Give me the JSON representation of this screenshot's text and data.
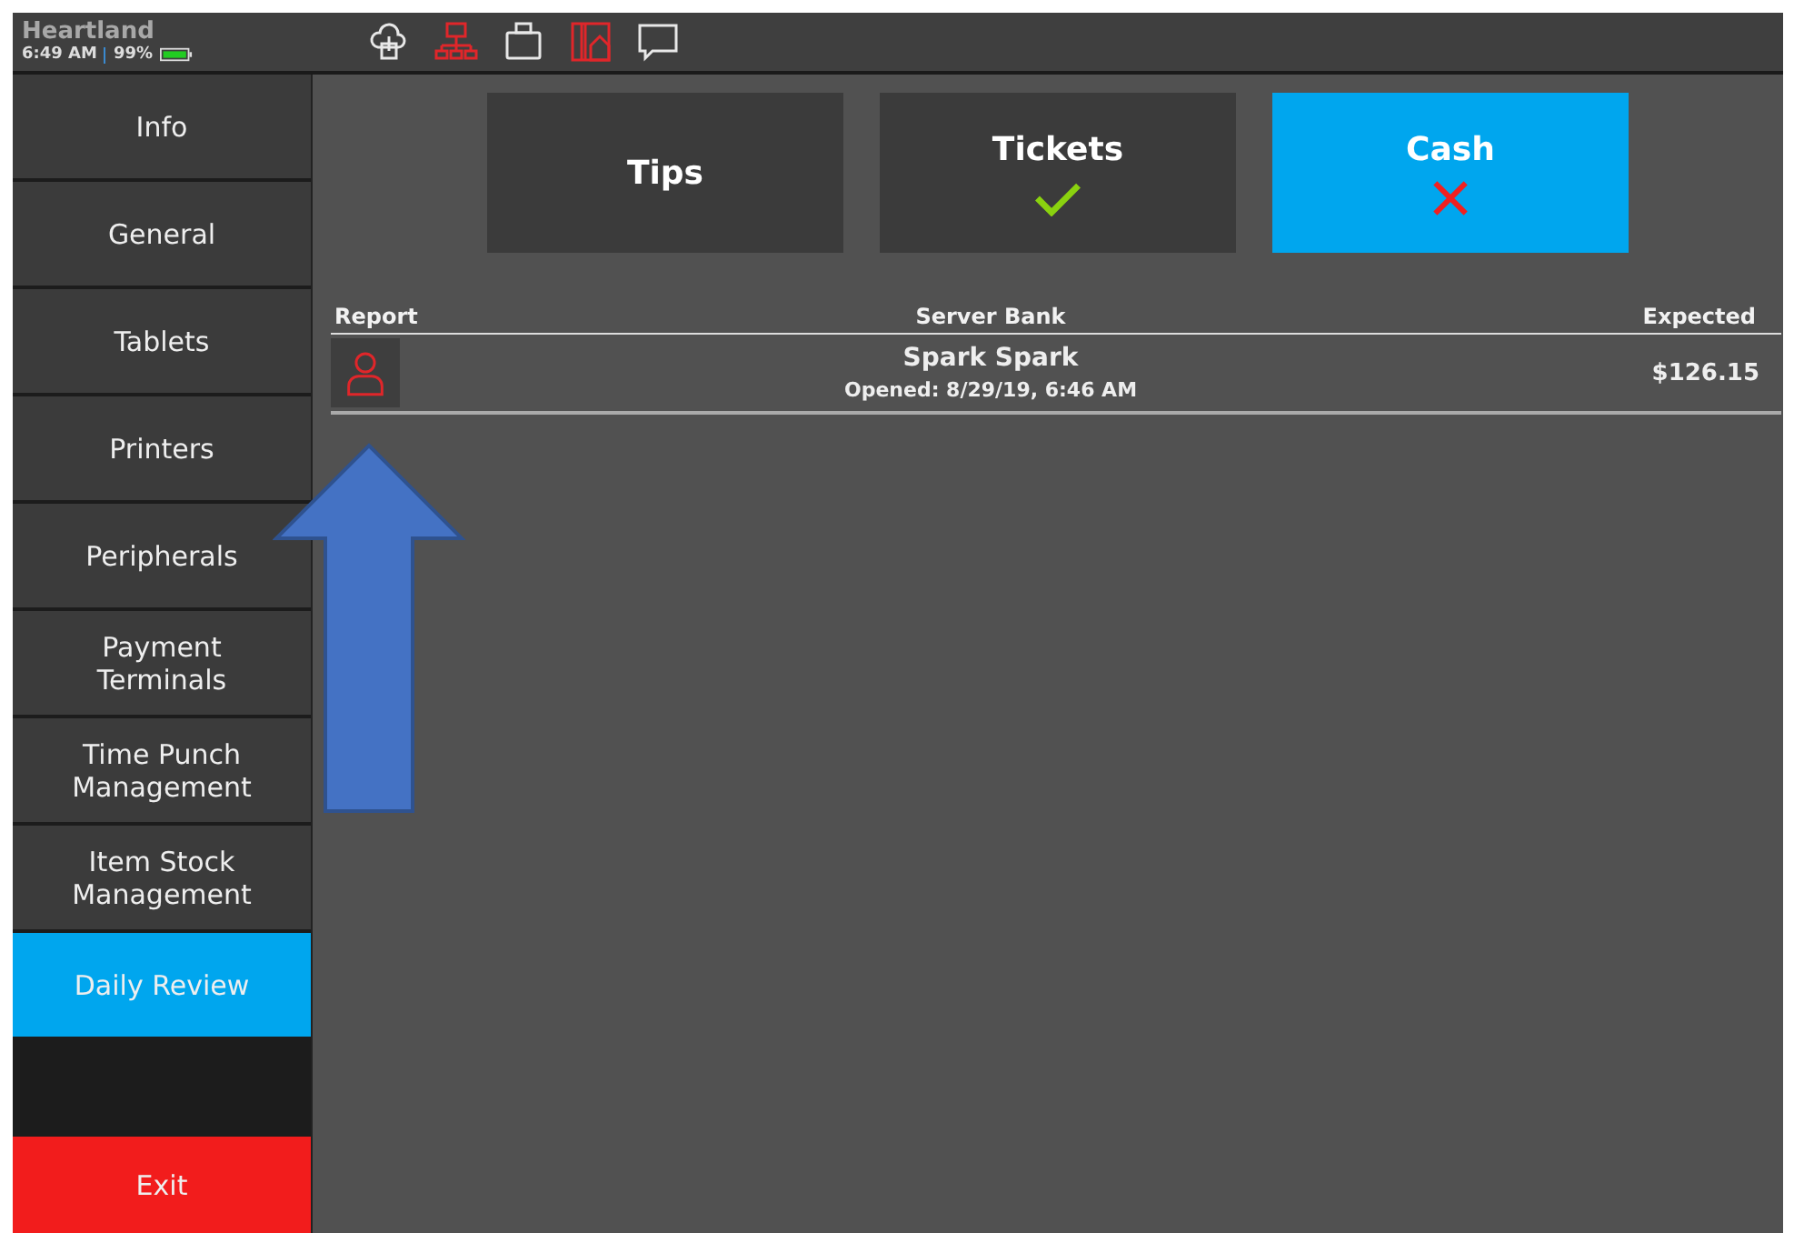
{
  "status_bar": {
    "brand": "Heartland",
    "time": "6:49 AM",
    "battery": "99%",
    "icons": [
      {
        "kind": "cloud",
        "alert": false
      },
      {
        "kind": "network",
        "alert": true
      },
      {
        "kind": "printer",
        "alert": false
      },
      {
        "kind": "card",
        "alert": true
      },
      {
        "kind": "chat",
        "alert": false
      }
    ]
  },
  "sidebar": {
    "items": [
      {
        "label": "Info",
        "selected": false
      },
      {
        "label": "General",
        "selected": false
      },
      {
        "label": "Tablets",
        "selected": false
      },
      {
        "label": "Printers",
        "selected": false
      },
      {
        "label": "Peripherals",
        "selected": false
      },
      {
        "label": "Payment Terminals",
        "selected": false
      },
      {
        "label": "Time Punch Management",
        "selected": false
      },
      {
        "label": "Item Stock Management",
        "selected": false
      },
      {
        "label": "Daily Review",
        "selected": true
      }
    ],
    "exit": "Exit"
  },
  "tabs": [
    {
      "label": "Tips",
      "selected": false,
      "kind": "plain"
    },
    {
      "label": "Tickets",
      "selected": false,
      "kind": "check"
    },
    {
      "label": "Cash",
      "selected": true,
      "kind": "cross"
    }
  ],
  "table": {
    "columns": [
      "Report",
      "Server Bank",
      "Expected"
    ],
    "rows": [
      {
        "name": "Spark Spark",
        "opened": "Opened: 8/29/19, 6:46 AM",
        "expected": "$126.15"
      }
    ]
  }
}
